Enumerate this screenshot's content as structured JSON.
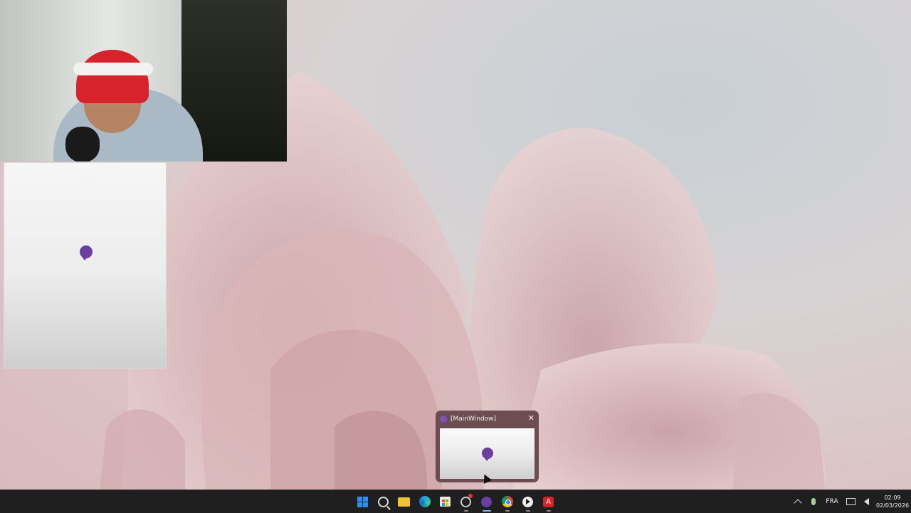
{
  "desktop": {
    "accent_color": "#d9b9bc",
    "background_description": "pink floral wallpaper"
  },
  "webcam": {
    "icon": "webcam-feed"
  },
  "app_window": {
    "icon": "chat-bubble-icon",
    "icon_color": "#6a3fa0"
  },
  "thumbnail": {
    "title": "[MainWindow]",
    "close_glyph": "✕",
    "icon": "chat-bubble-icon"
  },
  "taskbar": {
    "apps": [
      {
        "name": "start",
        "icon": "windows-logo-icon"
      },
      {
        "name": "search",
        "icon": "search-icon"
      },
      {
        "name": "file-explorer",
        "icon": "folder-icon"
      },
      {
        "name": "edge",
        "icon": "edge-browser-icon"
      },
      {
        "name": "store",
        "icon": "microsoft-store-icon"
      },
      {
        "name": "obs",
        "icon": "obs-icon"
      },
      {
        "name": "main-app",
        "icon": "chat-bubble-icon"
      },
      {
        "name": "chrome",
        "icon": "chrome-icon"
      },
      {
        "name": "media-player",
        "icon": "play-icon"
      },
      {
        "name": "acrobat",
        "icon": "acrobat-icon",
        "glyph": "A"
      }
    ],
    "tray": {
      "language": "FRA",
      "time": "02:09",
      "date": "02/03/2026"
    }
  }
}
